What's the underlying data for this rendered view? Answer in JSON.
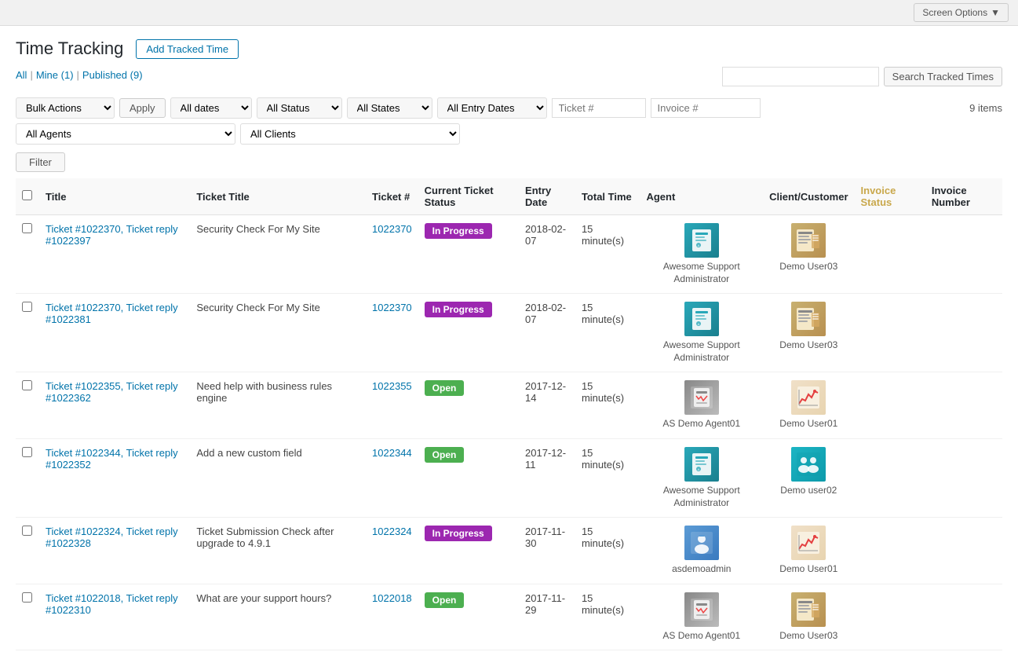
{
  "page": {
    "title": "Time Tracking",
    "add_btn_label": "Add Tracked Time",
    "screen_options_label": "Screen Options"
  },
  "filter_links": [
    {
      "label": "All",
      "href": "#",
      "active": true
    },
    {
      "label": "Mine (1)",
      "href": "#",
      "active": false
    },
    {
      "label": "Published (9)",
      "href": "#",
      "active": false
    }
  ],
  "search": {
    "placeholder": "",
    "btn_label": "Search Tracked Times"
  },
  "toolbar": {
    "bulk_actions_label": "Bulk Actions",
    "apply_label": "Apply",
    "dates_options": [
      "All dates"
    ],
    "status_options": [
      "All Status"
    ],
    "states_options": [
      "All States"
    ],
    "entry_dates_options": [
      "All Entry Dates"
    ],
    "ticket_placeholder": "Ticket #",
    "invoice_placeholder": "Invoice #",
    "items_count": "9 items",
    "agents_placeholder": "All Agents",
    "clients_placeholder": "All Clients",
    "filter_label": "Filter"
  },
  "table": {
    "columns": [
      "Title",
      "Ticket Title",
      "Ticket #",
      "Current Ticket Status",
      "Entry Date",
      "Total Time",
      "Agent",
      "Client/Customer",
      "Invoice Status",
      "Invoice Number"
    ],
    "rows": [
      {
        "title": "Ticket #1022370, Ticket reply #1022397",
        "ticket_title": "Security Check For My Site",
        "ticket_num": "1022370",
        "status": "In Progress",
        "status_type": "progress",
        "entry_date": "2018-02-07",
        "total_time": "15 minute(s)",
        "agent_name": "Awesome Support Administrator",
        "agent_avatar_type": "blue",
        "client_name": "Demo User03",
        "client_avatar_type": "beige",
        "invoice_status": "",
        "invoice_number": ""
      },
      {
        "title": "Ticket #1022370, Ticket reply #1022381",
        "ticket_title": "Security Check For My Site",
        "ticket_num": "1022370",
        "status": "In Progress",
        "status_type": "progress",
        "entry_date": "2018-02-07",
        "total_time": "15 minute(s)",
        "agent_name": "Awesome Support Administrator",
        "agent_avatar_type": "blue",
        "client_name": "Demo User03",
        "client_avatar_type": "beige",
        "invoice_status": "",
        "invoice_number": ""
      },
      {
        "title": "Ticket #1022355, Ticket reply #1022362",
        "ticket_title": "Need help with business rules engine",
        "ticket_num": "1022355",
        "status": "Open",
        "status_type": "open",
        "entry_date": "2017-12-14",
        "total_time": "15 minute(s)",
        "agent_name": "AS Demo Agent01",
        "agent_avatar_type": "gray",
        "client_name": "Demo User01",
        "client_avatar_type": "red-chart",
        "invoice_status": "",
        "invoice_number": ""
      },
      {
        "title": "Ticket #1022344, Ticket reply #1022352",
        "ticket_title": "Add a new custom field",
        "ticket_num": "1022344",
        "status": "Open",
        "status_type": "open",
        "entry_date": "2017-12-11",
        "total_time": "15 minute(s)",
        "agent_name": "Awesome Support Administrator",
        "agent_avatar_type": "blue",
        "client_name": "Demo user02",
        "client_avatar_type": "teal-team",
        "invoice_status": "",
        "invoice_number": ""
      },
      {
        "title": "Ticket #1022324, Ticket reply #1022328",
        "ticket_title": "Ticket Submission Check after upgrade to 4.9.1",
        "ticket_num": "1022324",
        "status": "In Progress",
        "status_type": "progress",
        "entry_date": "2017-11-30",
        "total_time": "15 minute(s)",
        "agent_name": "asdemoadmin",
        "agent_avatar_type": "blue2",
        "client_name": "Demo User01",
        "client_avatar_type": "red-chart",
        "invoice_status": "",
        "invoice_number": ""
      },
      {
        "title": "Ticket #1022018, Ticket reply #1022310",
        "ticket_title": "What are your support hours?",
        "ticket_num": "1022018",
        "status": "Open",
        "status_type": "open",
        "entry_date": "2017-11-29",
        "total_time": "15 minute(s)",
        "agent_name": "AS Demo Agent01",
        "agent_avatar_type": "gray",
        "client_name": "Demo User03",
        "client_avatar_type": "beige",
        "invoice_status": "",
        "invoice_number": ""
      }
    ]
  }
}
